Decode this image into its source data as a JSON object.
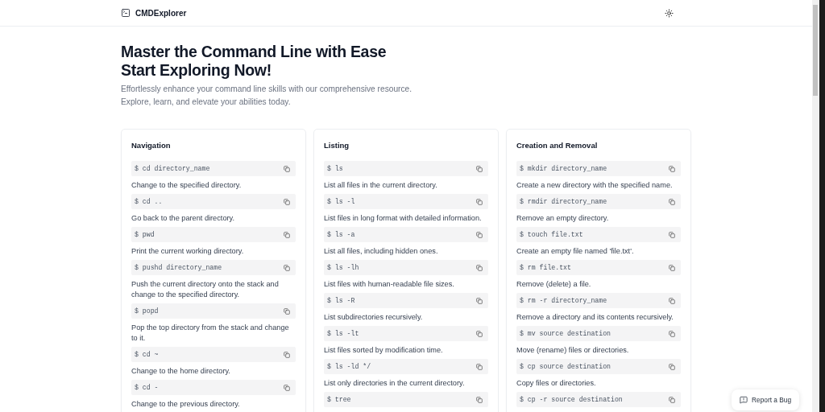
{
  "header": {
    "brand": "CMDExplorer"
  },
  "hero": {
    "title_lines": [
      "Master the Command Line with Ease",
      "Start Exploring Now!"
    ],
    "subtitle_lines": [
      "Effortlessly enhance your command line skills with our comprehensive resource.",
      "Explore, learn, and elevate your abilities today."
    ]
  },
  "sections": [
    {
      "title": "Navigation",
      "commands": [
        {
          "command": "$ cd directory_name",
          "description": "Change to the specified directory."
        },
        {
          "command": "$ cd ..",
          "description": "Go back to the parent directory."
        },
        {
          "command": "$ pwd",
          "description": "Print the current working directory."
        },
        {
          "command": "$ pushd directory_name",
          "description": "Push the current directory onto the stack and change to the specified directory."
        },
        {
          "command": "$ popd",
          "description": "Pop the top directory from the stack and change to it."
        },
        {
          "command": "$ cd ~",
          "description": "Change to the home directory."
        },
        {
          "command": "$ cd -",
          "description": "Change to the previous directory."
        }
      ]
    },
    {
      "title": "Listing",
      "commands": [
        {
          "command": "$ ls",
          "description": "List all files in the current directory."
        },
        {
          "command": "$ ls -l",
          "description": "List files in long format with detailed information."
        },
        {
          "command": "$ ls -a",
          "description": "List all files, including hidden ones."
        },
        {
          "command": "$ ls -lh",
          "description": "List files with human-readable file sizes."
        },
        {
          "command": "$ ls -R",
          "description": "List subdirectories recursively."
        },
        {
          "command": "$ ls -lt",
          "description": "List files sorted by modification time."
        },
        {
          "command": "$ ls -ld */",
          "description": "List only directories in the current directory."
        },
        {
          "command": "$ tree"
        }
      ]
    },
    {
      "title": "Creation and Removal",
      "commands": [
        {
          "command": "$ mkdir directory_name",
          "description": "Create a new directory with the specified name."
        },
        {
          "command": "$ rmdir directory_name",
          "description": "Remove an empty directory."
        },
        {
          "command": "$ touch file.txt",
          "description": "Create an empty file named 'file.txt'."
        },
        {
          "command": "$ rm file.txt",
          "description": "Remove (delete) a file."
        },
        {
          "command": "$ rm -r directory_name",
          "description": "Remove a directory and its contents recursively."
        },
        {
          "command": "$ mv source destination",
          "description": "Move (rename) files or directories."
        },
        {
          "command": "$ cp source destination",
          "description": "Copy files or directories."
        },
        {
          "command": "$ cp -r source destination"
        }
      ]
    }
  ],
  "report_button": {
    "label": "Report a Bug"
  }
}
